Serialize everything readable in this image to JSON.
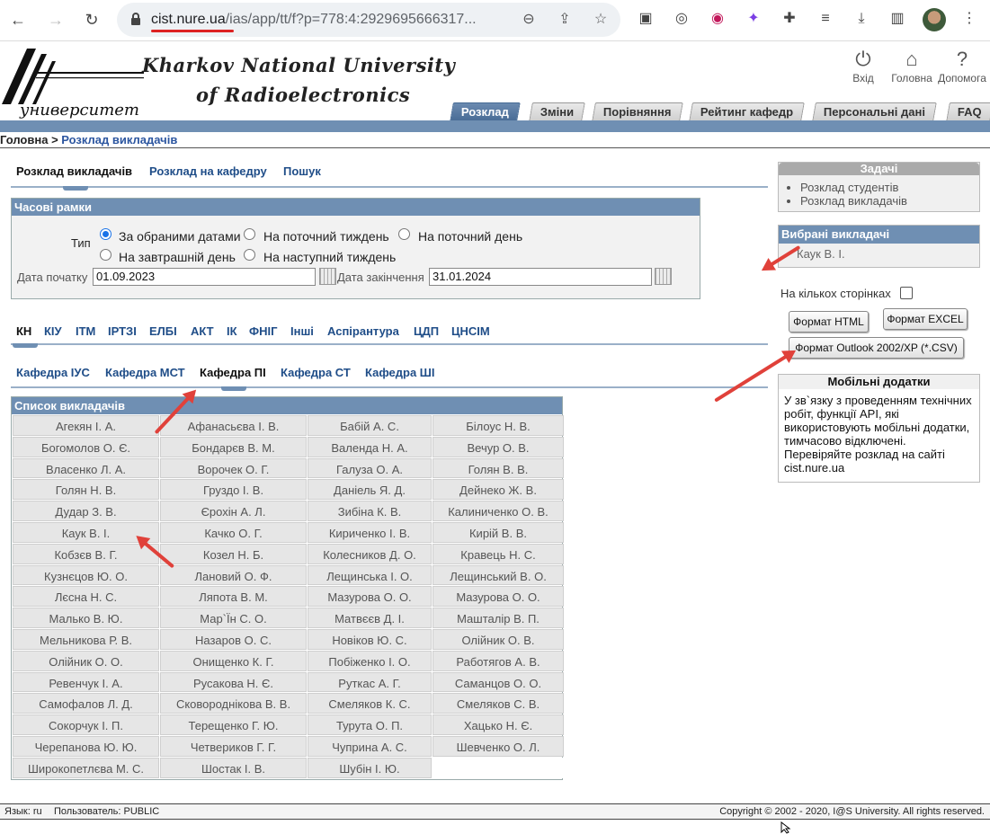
{
  "browser": {
    "url_host": "cist.nure.ua",
    "url_path": "/ias/app/tt/f?p=778:4:2929695666317..."
  },
  "header": {
    "university_line1": "Kharkov National University",
    "university_line2": "of Radioelectronics",
    "logo_text": "университет",
    "icons": [
      {
        "label": "Вхід",
        "icon": "power-icon"
      },
      {
        "label": "Головна",
        "icon": "home-icon"
      },
      {
        "label": "Допомога",
        "icon": "help-icon"
      }
    ],
    "tabs": [
      "Розклад",
      "Зміни",
      "Порівняння",
      "Рейтинг кафедр",
      "Персональні дані",
      "FAQ"
    ],
    "active_tab": "Розклад"
  },
  "breadcrumb": {
    "root": "Головна",
    "separator": " > ",
    "current": "Розклад викладачів"
  },
  "subtabs": [
    "Розклад викладачів",
    "Розклад на кафедру",
    "Пошук"
  ],
  "timeframe": {
    "title": "Часові рамки",
    "type_label": "Тип",
    "options": [
      "За обраними датами",
      "На поточний тиждень",
      "На поточний день",
      "На завтрашній день",
      "На наступний тиждень"
    ],
    "selected": "За обраними датами",
    "start_label": "Дата початку",
    "start_value": "01.09.2023",
    "end_label": "Дата закінчення",
    "end_value": "31.01.2024"
  },
  "faculties": [
    "КН",
    "КІУ",
    "ІТМ",
    "ІРТЗІ",
    "ЕЛБІ",
    "АКТ",
    "ІК",
    "ФНІГ",
    "Інші",
    "Аспірантура",
    "ЦДП",
    "ЦНСІМ"
  ],
  "departments": [
    "Кафедра ІУС",
    "Кафедра МСТ",
    "Кафедра ПІ",
    "Кафедра СТ",
    "Кафедра ШІ"
  ],
  "teachers_title": "Список викладачів",
  "teachers": [
    "Агекян І. А.",
    "Афанасьєва І. В.",
    "Бабій А. С.",
    "Білоус Н. В.",
    "Богомолов О. Є.",
    "Бондарєв В. М.",
    "Валенда Н. А.",
    "Вечур О. В.",
    "Власенко Л. А.",
    "Ворочек О. Г.",
    "Галуза О. А.",
    "Голян В. В.",
    "Голян Н. В.",
    "Груздо І. В.",
    "Даніель Я. Д.",
    "Дейнеко Ж. В.",
    "Дудар З. В.",
    "Єрохін А. Л.",
    "Зибіна К. В.",
    "Калиниченко О. В.",
    "Каук В. І.",
    "Качко О. Г.",
    "Кириченко І. В.",
    "Кирій В. В.",
    "Кобзєв В. Г.",
    "Козел Н. Б.",
    "Колесников Д. О.",
    "Кравець Н. С.",
    "Кузнєцов Ю. О.",
    "Лановий О. Ф.",
    "Лещинська І. О.",
    "Лещинський В. О.",
    "Лєсна Н. С.",
    "Ляпота В. М.",
    "Мазурова О. О.",
    "Мазурова О. О.",
    "Малько В. Ю.",
    "Мар`Їн С. О.",
    "Матвєєв Д. І.",
    "Машталір В. П.",
    "Мельникова Р. В.",
    "Назаров О. С.",
    "Новіков Ю. С.",
    "Олійник О. В.",
    "Олійник О. О.",
    "Онищенко К. Г.",
    "Побіженко І. О.",
    "Работягов А. В.",
    "Ревенчук І. А.",
    "Русакова Н. Є.",
    "Руткас А. Г.",
    "Саманцов О. О.",
    "Самофалов Л. Д.",
    "Сковороднікова В. В.",
    "Смеляков К. С.",
    "Смеляков С. В.",
    "Сокорчук І. П.",
    "Терещенко Г. Ю.",
    "Турута О. П.",
    "Хацько Н. Є.",
    "Черепанова Ю. Ю.",
    "Четвериков Г. Г.",
    "Чуприна А. С.",
    "Шевченко О. Л.",
    "Широкопетлєва М. С.",
    "Шостак І. В.",
    "Шубін І. Ю.",
    ""
  ],
  "tasks": {
    "title": "Задачі",
    "items": [
      "Розклад студентів",
      "Розклад викладачів"
    ]
  },
  "selected_teachers": {
    "title": "Вибрані викладачі",
    "items": [
      "Каук В. І."
    ]
  },
  "multi_page_label": "На кількох сторінках",
  "buttons": {
    "html": "Формат HTML",
    "excel": "Формат EXCEL",
    "csv": "Формат Outlook 2002/XP (*.CSV)"
  },
  "mobile": {
    "title": "Мобільні додатки",
    "text": "У зв`язку з проведенням технічних робіт, функції API, які використовують мобільні додатки, тимчасово відключені. Перевіряйте розклад на сайті cist.nure.ua"
  },
  "footer": {
    "lang": "Язык: ru",
    "user": "Пользователь: PUBLIC",
    "copyright": "Copyright © 2002 - 2020, I@S University. All rights reserved."
  },
  "colors": {
    "accent": "#6f8fb3",
    "link": "#1f4d88",
    "annotation": "#e0413a"
  }
}
